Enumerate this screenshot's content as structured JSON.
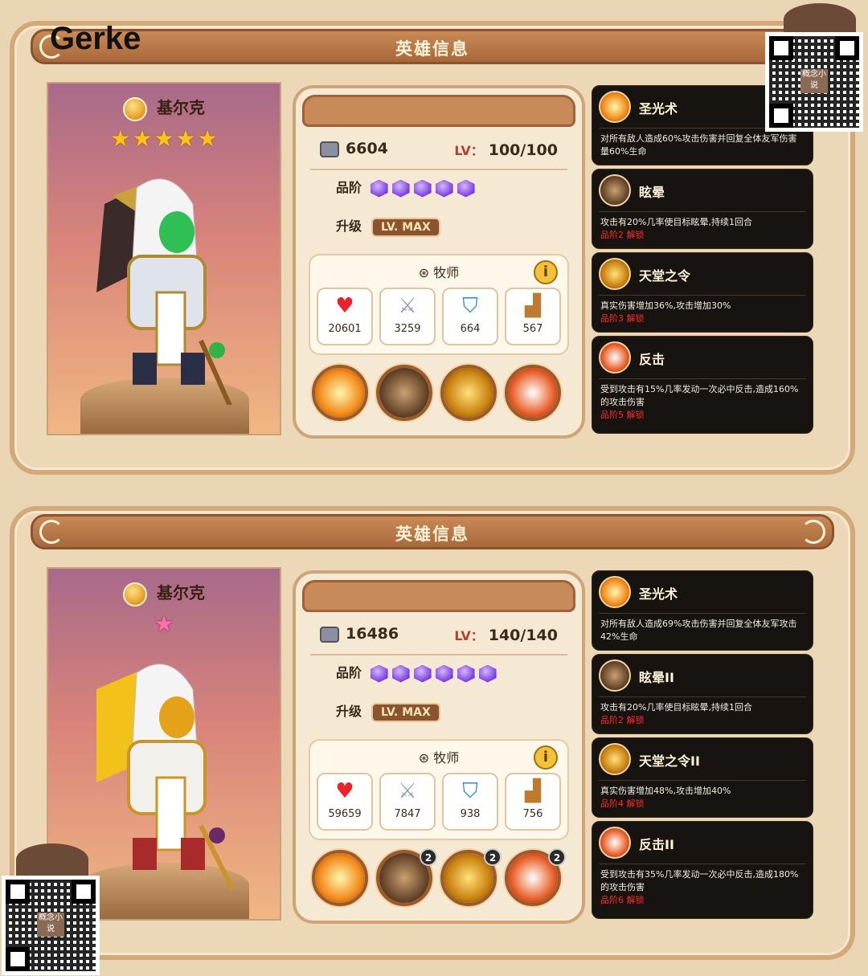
{
  "watermark": "Gerke",
  "panels": [
    {
      "title": "英雄信息",
      "hero_name": "基尔克",
      "stars": 5,
      "power": "6604",
      "lv_label": "LV：",
      "lv_value": "100/100",
      "grade_label": "品阶",
      "grade_gems": 5,
      "upgrade_label": "升级",
      "upgrade_value": "LV. MAX",
      "class_label": "牧师",
      "info_icon": "i",
      "stats": {
        "hp": "20601",
        "atk": "3259",
        "def": "664",
        "spd": "567"
      },
      "skills": [
        {
          "name": "圣光术",
          "desc": "对所有敌人造成60%攻击伤害并回复全体友军伤害量60%生命",
          "lock": ""
        },
        {
          "name": "眩晕",
          "desc": "攻击有20%几率使目标眩晕,持续1回合",
          "lock": "品阶2 解锁"
        },
        {
          "name": "天堂之令",
          "desc": "真实伤害增加36%,攻击增加30%",
          "lock": "品阶3 解锁"
        },
        {
          "name": "反击",
          "desc": "受到攻击有15%几率发动一次必中反击,造成160%的攻击伤害",
          "lock": "品阶5 解锁"
        }
      ]
    },
    {
      "title": "英雄信息",
      "hero_name": "基尔克",
      "stars": 1,
      "power": "16486",
      "lv_label": "LV：",
      "lv_value": "140/140",
      "grade_label": "品阶",
      "grade_gems": 6,
      "upgrade_label": "升级",
      "upgrade_value": "LV. MAX",
      "class_label": "牧师",
      "info_icon": "i",
      "stats": {
        "hp": "59659",
        "atk": "7847",
        "def": "938",
        "spd": "756"
      },
      "skill_badge": "2",
      "skills": [
        {
          "name": "圣光术",
          "desc": "对所有敌人造成69%攻击伤害并回复全体友军攻击42%生命",
          "lock": ""
        },
        {
          "name": "眩晕II",
          "desc": "攻击有20%几率使目标眩晕,持续1回合",
          "lock": "品阶2 解锁"
        },
        {
          "name": "天堂之令II",
          "desc": "真实伤害增加48%,攻击增加40%",
          "lock": "品阶4 解锁"
        },
        {
          "name": "反击II",
          "desc": "受到攻击有35%几率发动一次必中反击,造成180%的攻击伤害",
          "lock": "品阶6 解锁"
        }
      ]
    }
  ],
  "qr_text": "概念小说",
  "colors": {
    "header": "#c98a57",
    "skill_bg": "#171310",
    "lock_red": "#ff2b2b",
    "star_gold": "#ffc21a",
    "gem_purple": "#7b3fe0"
  },
  "icons": [
    "heart-icon",
    "sword-icon",
    "shield-icon",
    "boot-icon",
    "faction-icon",
    "power-icon",
    "class-icon",
    "info-icon"
  ]
}
